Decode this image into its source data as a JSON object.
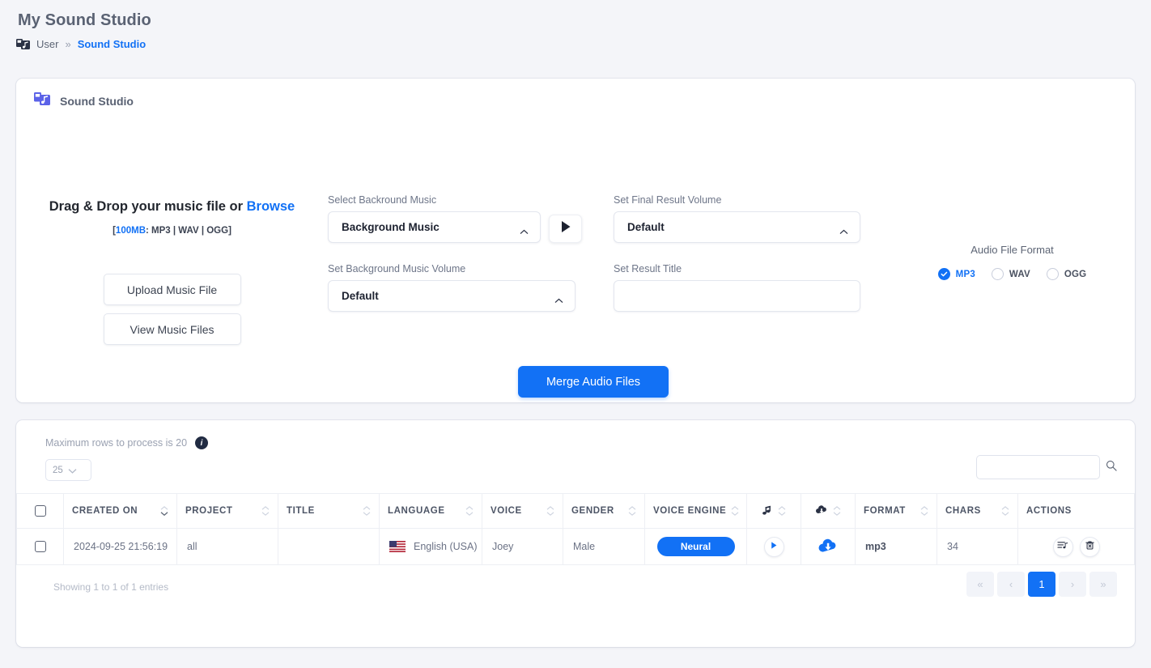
{
  "page": {
    "title": "My Sound Studio",
    "breadcrumb": {
      "icon": "sound-studio-icon",
      "parent": "User",
      "separator": "»",
      "current": "Sound Studio"
    }
  },
  "studio_card": {
    "icon": "sound-studio-icon",
    "title": "Sound Studio",
    "dropzone": {
      "headline_prefix": "Drag & Drop your music file or ",
      "browse_label": "Browse",
      "limit_open": "[",
      "limit_size": "100MB",
      "limit_formats": ": MP3 | WAV | OGG]",
      "upload_button": "Upload Music File",
      "view_button": "View Music Files"
    },
    "fields": {
      "bg_music": {
        "label": "Select Backround Music",
        "value": "Background Music",
        "caret": "chevron-up-icon"
      },
      "bg_volume": {
        "label": "Set Background Music Volume",
        "value": "Default",
        "caret": "chevron-up-icon"
      },
      "final_volume": {
        "label": "Set Final Result Volume",
        "value": "Default",
        "caret": "chevron-up-icon"
      },
      "result_title": {
        "label": "Set Result Title",
        "value": "",
        "placeholder": ""
      }
    },
    "preview_play": "play-icon",
    "audio_format": {
      "title": "Audio File Format",
      "selected": "MP3",
      "options": [
        {
          "label": "MP3",
          "checked": true
        },
        {
          "label": "WAV",
          "checked": false
        },
        {
          "label": "OGG",
          "checked": false
        }
      ]
    },
    "merge_button": "Merge Audio Files",
    "accent_color": "#1271f5"
  },
  "table_card": {
    "max_rows_note": "Maximum rows to process is 20",
    "info_icon": "info-icon",
    "page_length": "25",
    "search": {
      "value": "",
      "placeholder": ""
    },
    "columns": [
      {
        "key": "check",
        "label": "",
        "icon": "checkbox-icon",
        "sortable": false
      },
      {
        "key": "created",
        "label": "CREATED ON",
        "icon": null,
        "sortable": true
      },
      {
        "key": "project",
        "label": "PROJECT",
        "icon": null,
        "sortable": true
      },
      {
        "key": "title",
        "label": "TITLE",
        "icon": null,
        "sortable": true
      },
      {
        "key": "lang",
        "label": "LANGUAGE",
        "icon": null,
        "sortable": true
      },
      {
        "key": "voice",
        "label": "VOICE",
        "icon": null,
        "sortable": true
      },
      {
        "key": "gender",
        "label": "GENDER",
        "icon": null,
        "sortable": true
      },
      {
        "key": "engine",
        "label": "VOICE ENGINE",
        "icon": null,
        "sortable": true
      },
      {
        "key": "audio",
        "label": "",
        "icon": "music-note-icon",
        "sortable": true
      },
      {
        "key": "dl",
        "label": "",
        "icon": "cloud-download-icon",
        "sortable": true
      },
      {
        "key": "format",
        "label": "FORMAT",
        "icon": null,
        "sortable": true
      },
      {
        "key": "chars",
        "label": "CHARS",
        "icon": null,
        "sortable": true
      },
      {
        "key": "actions",
        "label": "ACTIONS",
        "icon": null,
        "sortable": false
      }
    ],
    "rows": [
      {
        "created": "2024-09-25 21:56:19",
        "project": "all",
        "title": "",
        "language": "English (USA)",
        "flag": "us-flag-icon",
        "voice": "Joey",
        "gender": "Male",
        "engine": "Neural",
        "play": "play-icon",
        "download": "cloud-download-icon",
        "format": "mp3",
        "chars": "34",
        "actions": [
          "playlist-icon",
          "delete-icon"
        ]
      }
    ],
    "entries_text": "Showing 1 to 1 of 1 entries",
    "pagination": {
      "first": "«",
      "prev": "‹",
      "pages": [
        "1"
      ],
      "current": "1",
      "next": "›",
      "last": "»"
    }
  }
}
